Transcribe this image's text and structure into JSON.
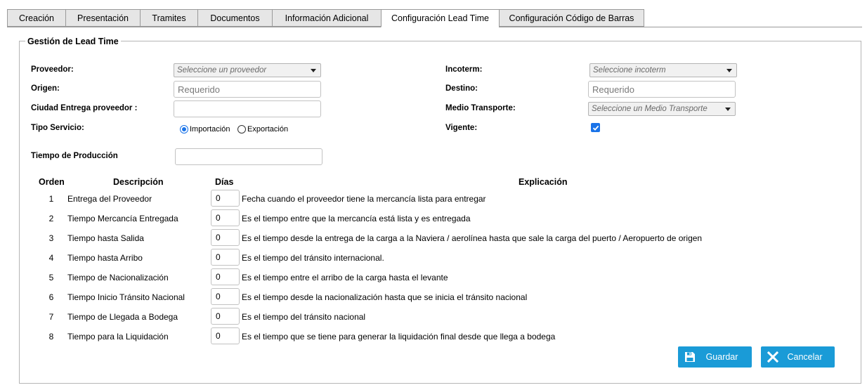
{
  "tabs": [
    {
      "label": "Creación"
    },
    {
      "label": "Presentación"
    },
    {
      "label": "Tramites"
    },
    {
      "label": "Documentos"
    },
    {
      "label": "Información Adicional"
    },
    {
      "label": "Configuración Lead Time",
      "active": true
    },
    {
      "label": "Configuración Código de Barras"
    }
  ],
  "section": {
    "legend": "Gestión de Lead Time"
  },
  "form": {
    "proveedor": {
      "label": "Proveedor:",
      "placeholder": "Seleccione un proveedor"
    },
    "origen": {
      "label": "Origen:",
      "placeholder": "Requerido"
    },
    "ciudad": {
      "label": "Ciudad Entrega proveedor :",
      "value": ""
    },
    "tipo_servicio": {
      "label": "Tipo Servicio:",
      "options": [
        "Importación",
        "Exportación"
      ],
      "selected": "Importación"
    },
    "tiempo_produccion": {
      "label": "Tiempo de Producción",
      "value": ""
    },
    "incoterm": {
      "label": "Incoterm:",
      "placeholder": "Seleccione incoterm"
    },
    "destino": {
      "label": "Destino:",
      "placeholder": "Requerido"
    },
    "medio_transporte": {
      "label": "Medio Transporte:",
      "placeholder": "Seleccione un Medio Transporte"
    },
    "vigente": {
      "label": "Vigente:",
      "checked": true
    }
  },
  "table": {
    "headers": {
      "orden": "Orden",
      "descripcion": "Descripción",
      "dias": "Días",
      "explicacion": "Explicación"
    },
    "rows": [
      {
        "orden": "1",
        "descripcion": "Entrega del Proveedor",
        "dias": "0",
        "explicacion": "Fecha cuando el proveedor tiene la mercancía lista para entregar"
      },
      {
        "orden": "2",
        "descripcion": "Tiempo Mercancía Entregada",
        "dias": "0",
        "explicacion": "Es el tiempo entre que la mercancía está lista y es entregada"
      },
      {
        "orden": "3",
        "descripcion": "Tiempo hasta Salida",
        "dias": "0",
        "explicacion": "Es el tiempo desde la entrega de la carga a la Naviera / aerolínea hasta que sale la carga del puerto / Aeropuerto de origen"
      },
      {
        "orden": "4",
        "descripcion": "Tiempo hasta Arribo",
        "dias": "0",
        "explicacion": "Es el tiempo del tránsito internacional."
      },
      {
        "orden": "5",
        "descripcion": "Tiempo de Nacionalización",
        "dias": "0",
        "explicacion": "Es el tiempo entre el arribo de la carga hasta el levante"
      },
      {
        "orden": "6",
        "descripcion": "Tiempo Inicio Tránsito Nacional",
        "dias": "0",
        "explicacion": "Es el tiempo desde la nacionalización hasta que se inicia el tránsito nacional"
      },
      {
        "orden": "7",
        "descripcion": "Tiempo de Llegada a Bodega",
        "dias": "0",
        "explicacion": "Es el tiempo del tránsito nacional"
      },
      {
        "orden": "8",
        "descripcion": "Tiempo para la Liquidación",
        "dias": "0",
        "explicacion": "Es el tiempo que se tiene para generar la liquidación final desde que llega a bodega"
      }
    ]
  },
  "buttons": {
    "guardar": {
      "label": "Guardar",
      "icon": "save-icon"
    },
    "cancelar": {
      "label": "Cancelar",
      "icon": "close-icon"
    }
  },
  "colors": {
    "accent": "#1a9bd7",
    "check": "#1a73e8"
  }
}
